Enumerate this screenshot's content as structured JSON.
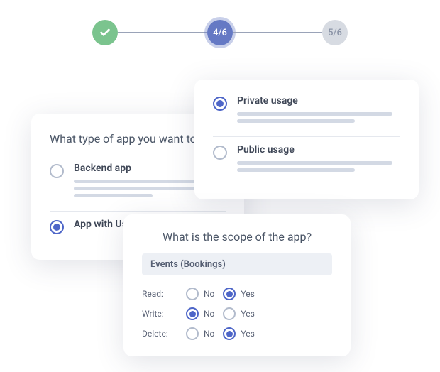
{
  "stepper": {
    "complete_icon": "check",
    "active_label": "4/6",
    "upcoming_label": "5/6"
  },
  "card_app_type": {
    "title": "What type of app you want to",
    "options": [
      {
        "label": "Backend app",
        "selected": false
      },
      {
        "label": "App with Us",
        "selected": true
      }
    ]
  },
  "card_usage": {
    "options": [
      {
        "label": "Private usage",
        "selected": true
      },
      {
        "label": "Public usage",
        "selected": false
      }
    ]
  },
  "card_scope": {
    "title": "What is the scope of the app?",
    "category": "Events (Bookings)",
    "rows": [
      {
        "key": "Read:",
        "no_selected": false,
        "yes_selected": true,
        "no": "No",
        "yes": "Yes"
      },
      {
        "key": "Write:",
        "no_selected": true,
        "yes_selected": false,
        "no": "No",
        "yes": "Yes"
      },
      {
        "key": "Delete:",
        "no_selected": false,
        "yes_selected": true,
        "no": "No",
        "yes": "Yes"
      }
    ]
  }
}
